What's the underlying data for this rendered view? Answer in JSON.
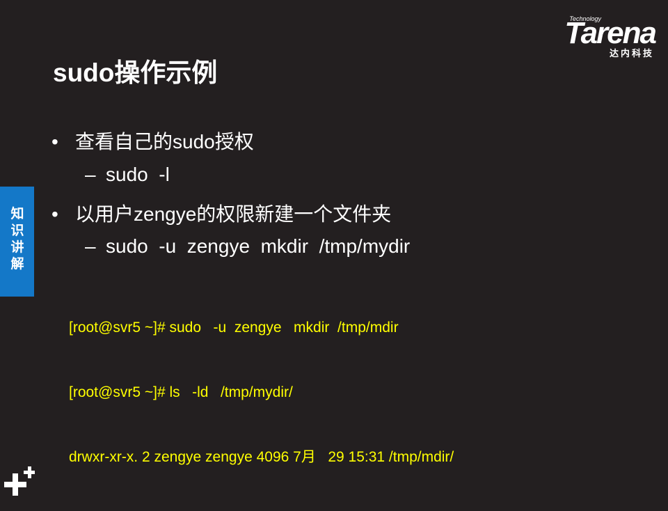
{
  "logo": {
    "technology": "Technology",
    "brand": "Tarena",
    "chinese": "达内科技"
  },
  "title": "sudo操作示例",
  "bullets": [
    {
      "level": 1,
      "text": "查看自己的sudo授权"
    },
    {
      "level": 2,
      "text": "sudo  -l"
    },
    {
      "level": 1,
      "text": "以用户zengye的权限新建一个文件夹"
    },
    {
      "level": 2,
      "text": "sudo  -u  zengye  mkdir  /tmp/mydir"
    }
  ],
  "markers": {
    "bullet": "•",
    "dash": "–"
  },
  "terminal": [
    "[root@svr5 ~]# sudo   -u  zengye   mkdir  /tmp/mdir",
    "[root@svr5 ~]# ls   -ld   /tmp/mydir/",
    "drwxr-xr-x. 2 zengye zengye 4096 7月   29 15:31 /tmp/mdir/"
  ],
  "side_tab": "知识讲解",
  "colors": {
    "background": "#231f20",
    "terminal_text": "#ffff00",
    "side_tab": "#1478c8"
  }
}
